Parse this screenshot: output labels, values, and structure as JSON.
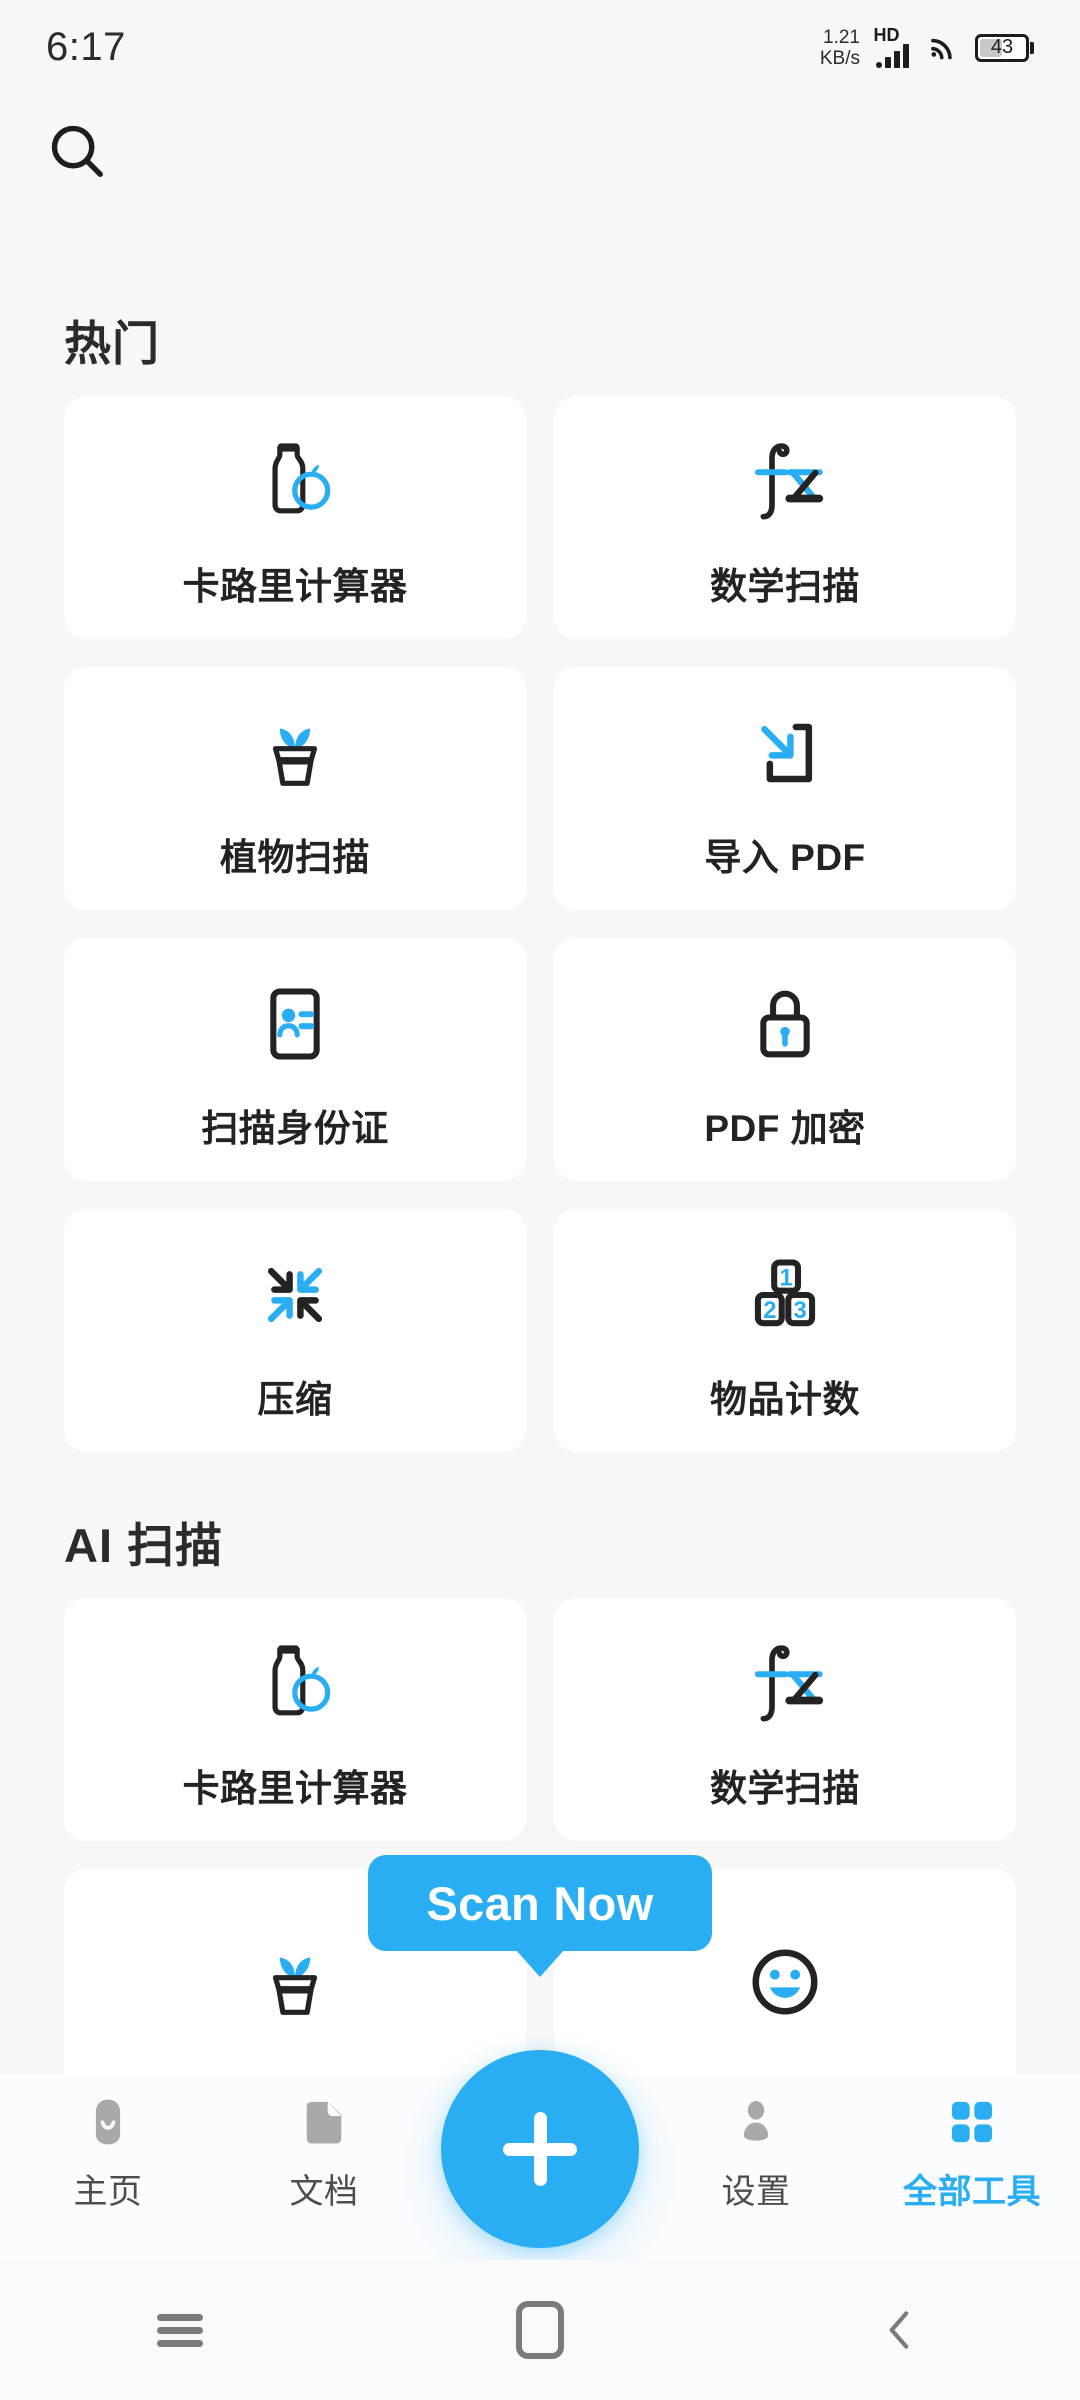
{
  "status_bar": {
    "time": "6:17",
    "net_speed_value": "1.21",
    "net_speed_unit": "KB/s",
    "hd_label": "HD",
    "battery_level": "43",
    "icons": [
      "signal-icon",
      "wifi-icon",
      "battery-icon"
    ]
  },
  "header": {
    "search_icon": "search-icon"
  },
  "sections": [
    {
      "title": "热门",
      "items": [
        {
          "label": "卡路里计算器",
          "icon": "bottle-apple-icon"
        },
        {
          "label": "数学扫描",
          "icon": "fx-math-icon"
        },
        {
          "label": "植物扫描",
          "icon": "plant-pot-icon"
        },
        {
          "label": "导入 PDF",
          "icon": "import-arrow-icon"
        },
        {
          "label": "扫描身份证",
          "icon": "id-card-icon"
        },
        {
          "label": "PDF 加密",
          "icon": "lock-icon"
        },
        {
          "label": "压缩",
          "icon": "compress-arrows-icon"
        },
        {
          "label": "物品计数",
          "icon": "number-blocks-icon"
        }
      ]
    },
    {
      "title": "AI 扫描",
      "items": [
        {
          "label": "卡路里计算器",
          "icon": "bottle-apple-icon"
        },
        {
          "label": "数学扫描",
          "icon": "fx-math-icon"
        },
        {
          "label": "",
          "icon": "plant-pot-icon"
        },
        {
          "label": "",
          "icon": "smiley-face-icon"
        }
      ]
    }
  ],
  "fab": {
    "tooltip_label": "Scan Now",
    "icon": "plus-icon"
  },
  "bottom_nav": {
    "items": [
      {
        "label": "主页",
        "icon": "home-icon",
        "active": false
      },
      {
        "label": "文档",
        "icon": "document-icon",
        "active": false
      },
      {
        "label": "设置",
        "icon": "person-icon",
        "active": false
      },
      {
        "label": "全部工具",
        "icon": "grid-icon",
        "active": true
      }
    ]
  },
  "android_nav": {
    "recents": "recents-icon",
    "home": "home-square-icon",
    "back": "back-chevron-icon"
  },
  "colors": {
    "accent": "#29aef4",
    "dark": "#232323",
    "page_bg": "#f7f7f8",
    "card_bg": "#ffffff"
  }
}
